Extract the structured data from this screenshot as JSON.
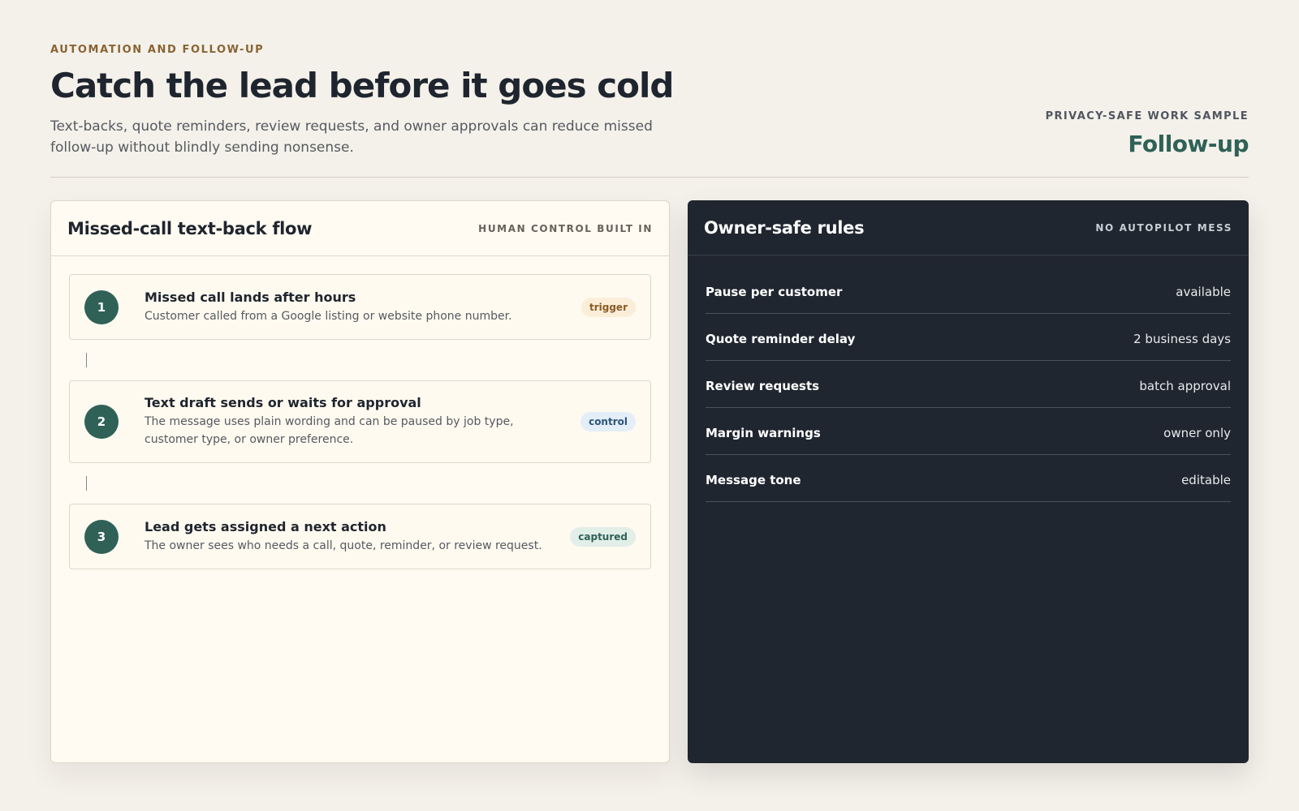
{
  "header": {
    "eyebrow": "AUTOMATION AND FOLLOW-UP",
    "title": "Catch the lead before it goes cold",
    "subtitle": "Text-backs, quote reminders, review requests, and owner approvals can reduce missed follow-up without blindly sending nonsense.",
    "right_label": "PRIVACY-SAFE WORK SAMPLE",
    "right_value": "Follow-up"
  },
  "flow": {
    "title": "Missed-call text-back flow",
    "tag": "HUMAN CONTROL BUILT IN",
    "steps": [
      {
        "num": "1",
        "title": "Missed call lands after hours",
        "desc": "Customer called from a Google listing or website phone number.",
        "badge": "trigger"
      },
      {
        "num": "2",
        "title": "Text draft sends or waits for approval",
        "desc": "The message uses plain wording and can be paused by job type, customer type, or owner preference.",
        "badge": "control"
      },
      {
        "num": "3",
        "title": "Lead gets assigned a next action",
        "desc": "The owner sees who needs a call, quote, reminder, or review request.",
        "badge": "captured"
      }
    ]
  },
  "rules": {
    "title": "Owner-safe rules",
    "tag": "NO AUTOPILOT MESS",
    "items": [
      {
        "name": "Pause per customer",
        "value": "available"
      },
      {
        "name": "Quote reminder delay",
        "value": "2 business days"
      },
      {
        "name": "Review requests",
        "value": "batch approval"
      },
      {
        "name": "Margin warnings",
        "value": "owner only"
      },
      {
        "name": "Message tone",
        "value": "editable"
      }
    ]
  },
  "colors": {
    "accent": "#2f6157",
    "eyebrow": "#8a6334",
    "dark_panel": "#20262f",
    "background": "#f4f1ea"
  }
}
